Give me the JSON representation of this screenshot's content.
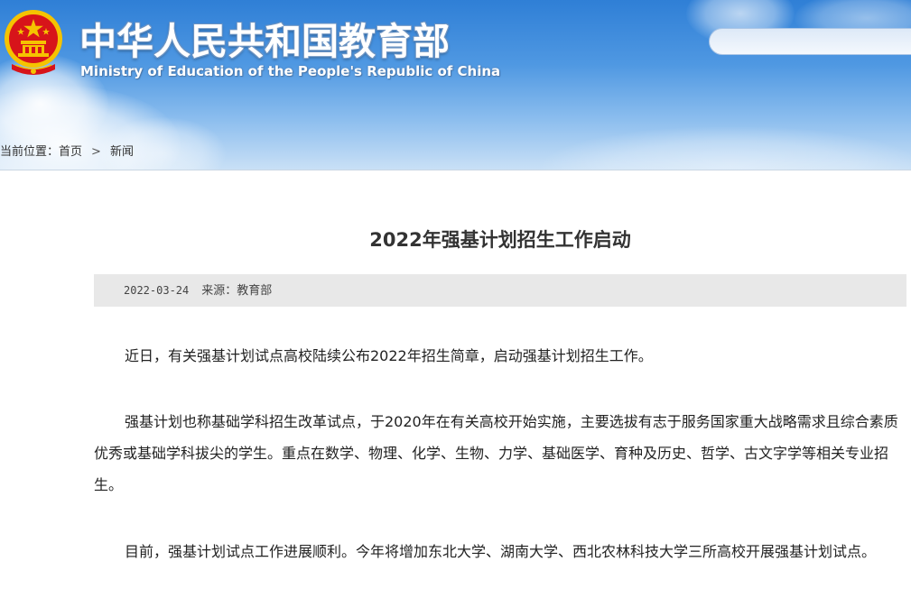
{
  "header": {
    "title_cn": "中华人民共和国教育部",
    "title_en": "Ministry of Education of the People's Republic of China",
    "search": {
      "value": "",
      "placeholder": ""
    },
    "emblem_icon": "national-emblem-icon"
  },
  "breadcrumb": {
    "prefix": "当前位置：",
    "home": "首页",
    "separator": ">",
    "current": "新闻"
  },
  "article": {
    "title": "2022年强基计划招生工作启动",
    "date": "2022-03-24",
    "source": "来源：教育部",
    "paragraphs": [
      "近日，有关强基计划试点高校陆续公布2022年招生简章，启动强基计划招生工作。",
      "强基计划也称基础学科招生改革试点，于2020年在有关高校开始实施，主要选拔有志于服务国家重大战略需求且综合素质优秀或基础学科拔尖的学生。重点在数学、物理、化学、生物、力学、基础医学、育种及历史、哲学、古文字学等相关专业招生。",
      "目前，强基计划试点工作进展顺利。今年将增加东北大学、湖南大学、西北农林科技大学三所高校开展强基计划试点。"
    ]
  },
  "colors": {
    "header_sky": "#4f98e2",
    "meta_bar_bg": "#e8e8e8",
    "text": "#222222",
    "emblem_red": "#d7141a",
    "emblem_gold": "#f5c300"
  }
}
